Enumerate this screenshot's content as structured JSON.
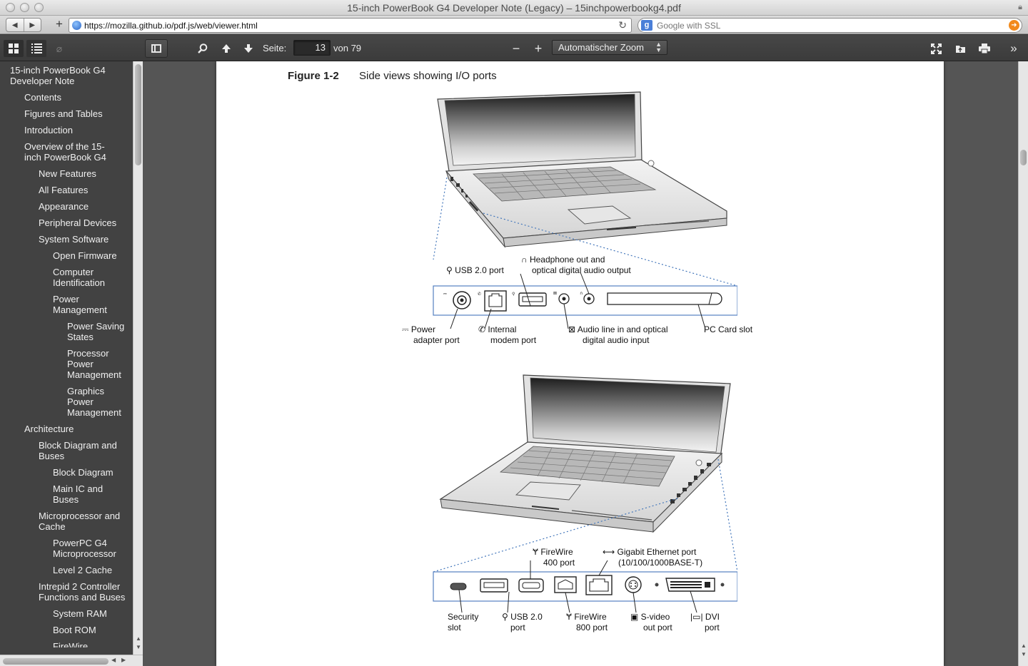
{
  "window": {
    "title": "15-inch PowerBook G4 Developer Note (Legacy) – 15inchpowerbookg4.pdf"
  },
  "browser": {
    "url": "https://mozilla.github.io/pdf.js/web/viewer.html",
    "search_placeholder": "Google with SSL",
    "search_engine_icon": "g-icon"
  },
  "pdf_toolbar": {
    "page_label": "Seite:",
    "page_value": "13",
    "page_count": "von 79",
    "zoom_value": "Automatischer Zoom"
  },
  "outline": [
    {
      "label": "15-inch PowerBook G4 Developer Note",
      "level": 0
    },
    {
      "label": "Contents",
      "level": 1
    },
    {
      "label": "Figures and Tables",
      "level": 1
    },
    {
      "label": "Introduction",
      "level": 1
    },
    {
      "label": "Overview of the 15-inch PowerBook G4",
      "level": 1
    },
    {
      "label": "New Features",
      "level": 2
    },
    {
      "label": "All Features",
      "level": 2
    },
    {
      "label": "Appearance",
      "level": 2
    },
    {
      "label": "Peripheral Devices",
      "level": 2
    },
    {
      "label": "System Software",
      "level": 2
    },
    {
      "label": "Open Firmware",
      "level": 3
    },
    {
      "label": "Computer Identification",
      "level": 3
    },
    {
      "label": "Power Management",
      "level": 3
    },
    {
      "label": "Power Saving States",
      "level": 4
    },
    {
      "label": "Processor Power Management",
      "level": 4
    },
    {
      "label": "Graphics Power Management",
      "level": 4
    },
    {
      "label": "Architecture",
      "level": 1
    },
    {
      "label": "Block Diagram and Buses",
      "level": 2
    },
    {
      "label": "Block Diagram",
      "level": 3
    },
    {
      "label": "Main IC and Buses",
      "level": 3
    },
    {
      "label": "Microprocessor and Cache",
      "level": 2
    },
    {
      "label": "PowerPC G4 Microprocessor",
      "level": 3
    },
    {
      "label": "Level 2 Cache",
      "level": 3
    },
    {
      "label": "Intrepid 2 Controller Functions and Buses",
      "level": 2
    },
    {
      "label": "System RAM",
      "level": 3
    },
    {
      "label": "Boot ROM",
      "level": 3
    },
    {
      "label": "FireWire Controller",
      "level": 3
    }
  ],
  "figure": {
    "number": "Figure 1-2",
    "title": "Side views showing I/O ports",
    "left_side": {
      "usb": "USB 2.0 port",
      "headphone_line1": "Headphone out and",
      "headphone_line2": "optical digital audio output",
      "power_line1": "Power",
      "power_line2": "adapter port",
      "modem_line1": "Internal",
      "modem_line2": "modem port",
      "audio_in_line1": "Audio line in and optical",
      "audio_in_line2": "digital audio input",
      "pccard": "PC Card slot"
    },
    "right_side": {
      "fw400_line1": "FireWire",
      "fw400_line2": "400 port",
      "ethernet_line1": "Gigabit Ethernet port",
      "ethernet_line2": "(10/100/1000BASE-T)",
      "security_line1": "Security",
      "security_line2": "slot",
      "usb_line1": "USB 2.0",
      "usb_line2": "port",
      "fw800_line1": "FireWire",
      "fw800_line2": "800 port",
      "svideo_line1": "S-video",
      "svideo_line2": "out port",
      "dvi_line1": "DVI",
      "dvi_line2": "port"
    }
  }
}
